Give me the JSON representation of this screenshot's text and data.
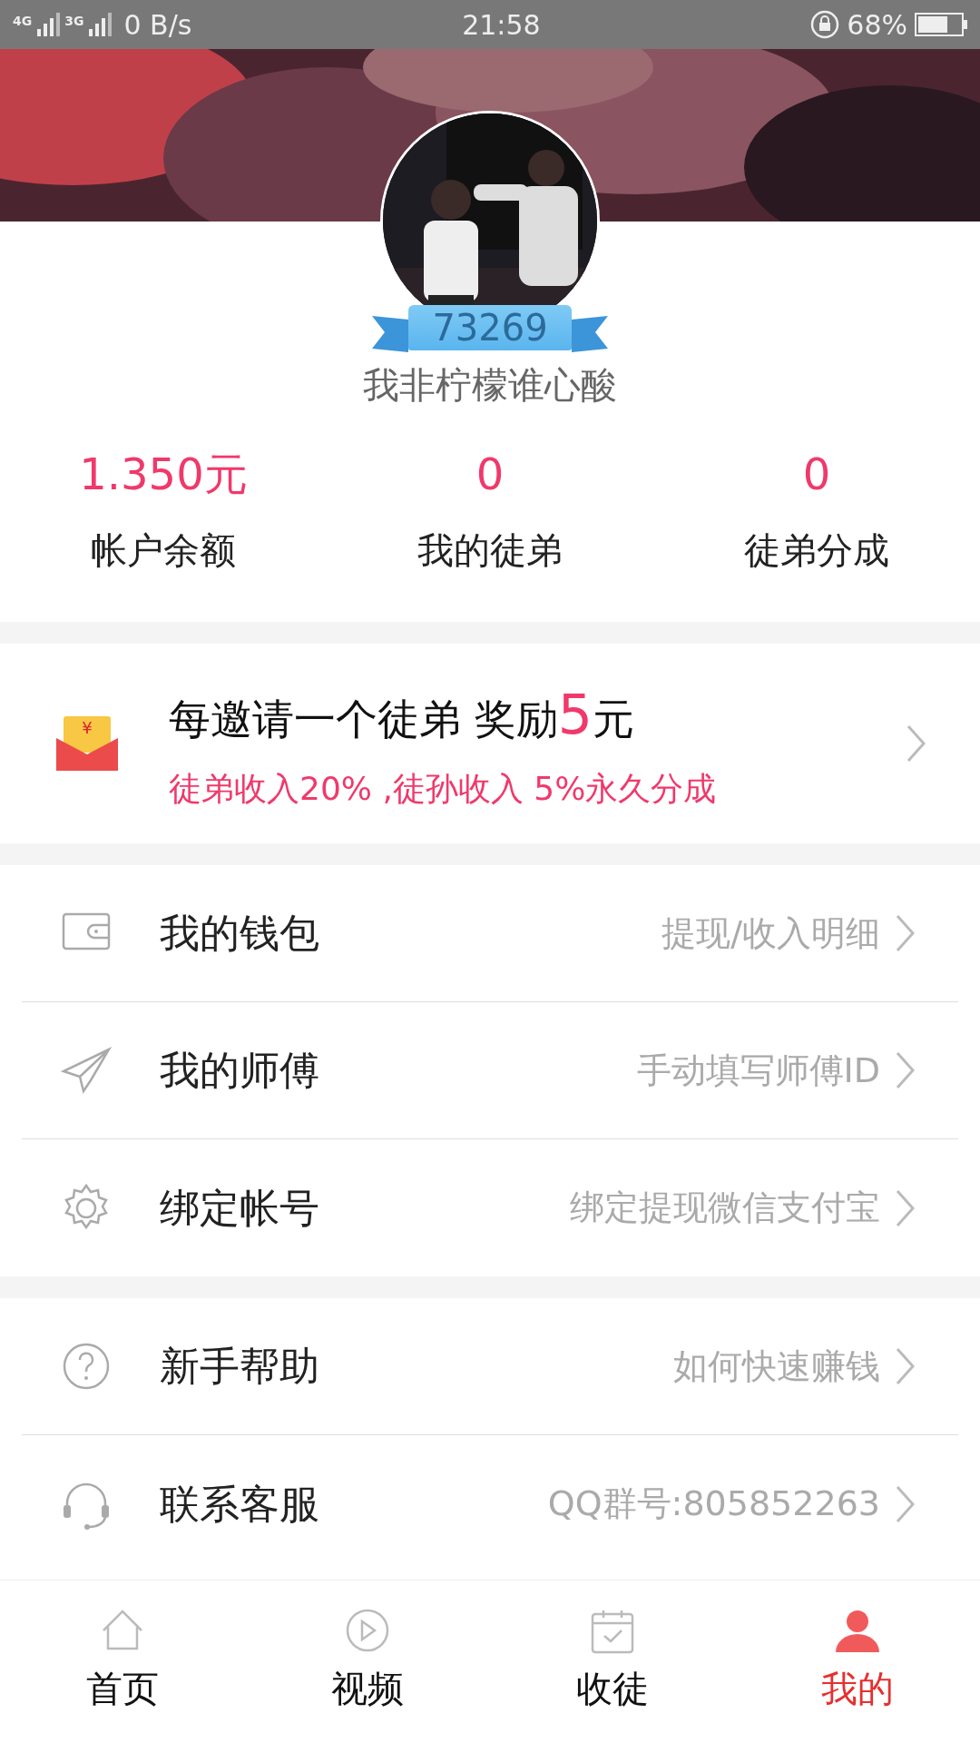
{
  "status_bar": {
    "networks": [
      "4G",
      "3G"
    ],
    "speed": "0 B/s",
    "time": "21:58",
    "battery": "68%"
  },
  "profile": {
    "level": "73269",
    "name": "我非柠檬谁心酸"
  },
  "stats": [
    {
      "value": "1.350元",
      "label": "帐户余额"
    },
    {
      "value": "0",
      "label": "我的徒弟"
    },
    {
      "value": "0",
      "label": "徒弟分成"
    }
  ],
  "promo": {
    "icon_symbol": "¥",
    "title": "每邀请一个徒弟 奖励",
    "amount": "5",
    "unit": "元",
    "subtitle": "徒弟收入20% ,徒孙收入 5%永久分成"
  },
  "sections": [
    [
      {
        "label": "我的钱包",
        "hint": "提现/收入明细"
      },
      {
        "label": "我的师傅",
        "hint": "手动填写师傅ID"
      },
      {
        "label": "绑定帐号",
        "hint": "绑定提现微信支付宝"
      }
    ],
    [
      {
        "label": "新手帮助",
        "hint": "如何快速赚钱"
      },
      {
        "label": "联系客服",
        "hint": "QQ群号:805852263"
      }
    ]
  ],
  "tab_bar": [
    {
      "label": "首页",
      "selected": false
    },
    {
      "label": "视频",
      "selected": false
    },
    {
      "label": "收徒",
      "selected": false
    },
    {
      "label": "我的",
      "selected": true
    }
  ]
}
